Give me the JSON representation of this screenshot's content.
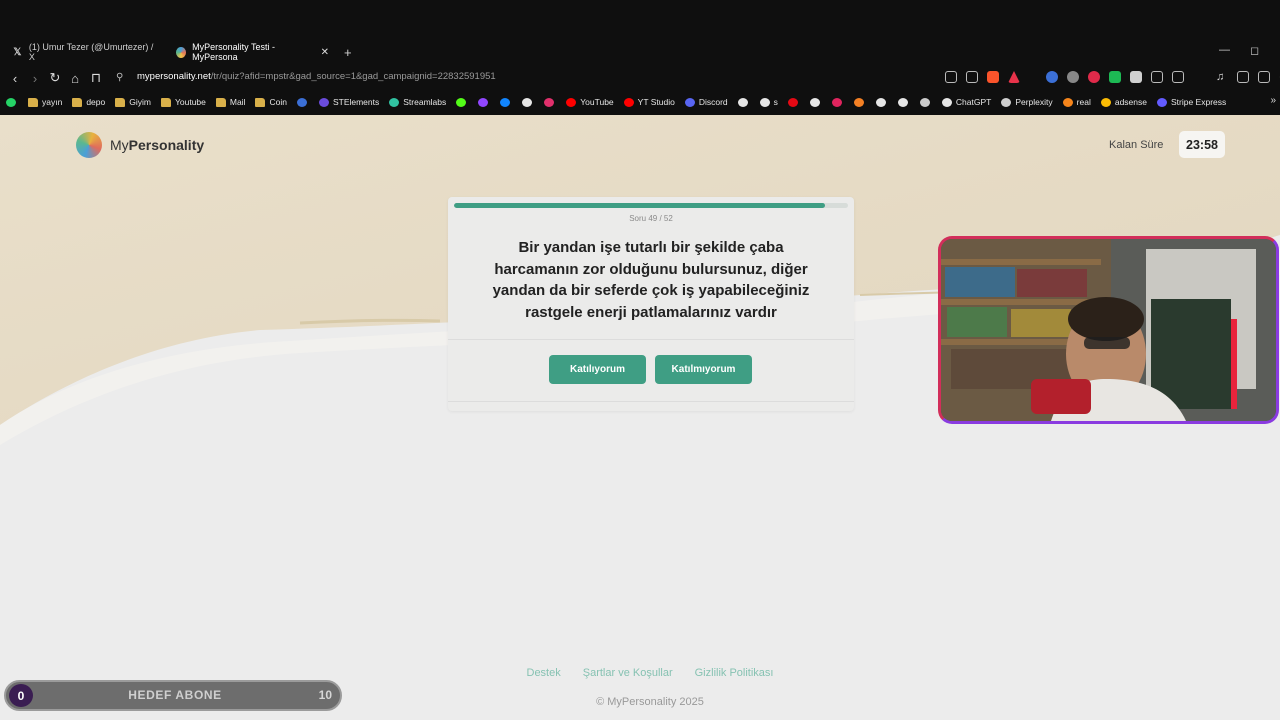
{
  "browser": {
    "tabs": [
      {
        "title": "(1) Umur Tezer (@Umurtezer) / X",
        "favicon": "x-icon"
      },
      {
        "title": "MyPersonality Testi - MyPersona",
        "favicon": "mypersonality-icon"
      }
    ],
    "new_tab": "+",
    "url_host": "mypersonality.net",
    "url_path": "/tr/quiz?afid=mpstr&gad_source=1&gad_campaignid=22832591951",
    "bookmarks": [
      {
        "label": "",
        "icon": "whatsapp-icon",
        "color": "#25d366"
      },
      {
        "label": "yayın",
        "icon": "folder-icon"
      },
      {
        "label": "depo",
        "icon": "folder-icon"
      },
      {
        "label": "Giyim",
        "icon": "folder-icon"
      },
      {
        "label": "Youtube",
        "icon": "folder-icon"
      },
      {
        "label": "Mail",
        "icon": "folder-icon"
      },
      {
        "label": "Coin",
        "icon": "folder-icon"
      },
      {
        "label": "",
        "icon": "r-icon",
        "color": "#3b6fd6"
      },
      {
        "label": "STElements",
        "icon": "stelements-icon",
        "color": "#6a4bdc"
      },
      {
        "label": "Streamlabs",
        "icon": "streamlabs-icon",
        "color": "#31c3a2"
      },
      {
        "label": "",
        "icon": "kick-icon",
        "color": "#53fc18"
      },
      {
        "label": "",
        "icon": "twitch-icon",
        "color": "#9146ff"
      },
      {
        "label": "",
        "icon": "bluesky-icon",
        "color": "#1185fe"
      },
      {
        "label": "",
        "icon": "x-icon",
        "color": "#e6e6e6"
      },
      {
        "label": "",
        "icon": "instagram-icon",
        "color": "#e1306c"
      },
      {
        "label": "YouTube",
        "icon": "youtube-icon",
        "color": "#ff0000"
      },
      {
        "label": "YT Studio",
        "icon": "yt-studio-icon",
        "color": "#ff0000"
      },
      {
        "label": "Discord",
        "icon": "discord-icon",
        "color": "#5865f2"
      },
      {
        "label": "",
        "icon": "tiktok-icon",
        "color": "#e6e6e6"
      },
      {
        "label": "s",
        "icon": "tiktok-icon",
        "color": "#e6e6e6"
      },
      {
        "label": "",
        "icon": "netflix-icon",
        "color": "#e50914"
      },
      {
        "label": "",
        "icon": "circle-icon",
        "color": "#e6e6e6"
      },
      {
        "label": "",
        "icon": "app-icon",
        "color": "#e0245e"
      },
      {
        "label": "",
        "icon": "app-icon",
        "color": "#f48024"
      },
      {
        "label": "",
        "icon": "amazon-icon",
        "color": "#e6e6e6"
      },
      {
        "label": "",
        "icon": "app-icon",
        "color": "#e6e6e6"
      },
      {
        "label": "",
        "icon": "app-icon",
        "color": "#cccccc"
      },
      {
        "label": "ChatGPT",
        "icon": "chatgpt-icon",
        "color": "#e6e6e6"
      },
      {
        "label": "Perplexity",
        "icon": "perplexity-icon",
        "color": "#cfcfcf"
      },
      {
        "label": "real",
        "icon": "fox-icon",
        "color": "#f6851b"
      },
      {
        "label": "adsense",
        "icon": "adsense-icon",
        "color": "#fbbc04"
      },
      {
        "label": "Stripe Express",
        "icon": "stripe-icon",
        "color": "#635bff"
      }
    ]
  },
  "header": {
    "logo_prefix": "My",
    "logo_bold": "Personality",
    "timer_label": "Kalan Süre",
    "timer_value": "23:58"
  },
  "quiz": {
    "progress_fraction": 0.9423,
    "counter": "Soru 49 / 52",
    "question": "Bir yandan işe tutarlı bir şekilde çaba harcamanın zor olduğunu bulursunuz, diğer yandan da bir seferde çok iş yapabileceğiniz rastgele enerji patlamalarınız vardır",
    "agree_label": "Katılıyorum",
    "disagree_label": "Katılmıyorum"
  },
  "footer": {
    "links": [
      "Destek",
      "Şartlar ve Koşullar",
      "Gizlilik Politikası"
    ],
    "copyright": "© MyPersonality 2025"
  },
  "stream_overlay": {
    "goal_current": "0",
    "goal_label": "HEDEF ABONE",
    "goal_target": "10"
  },
  "colors": {
    "accent": "#3f9e84",
    "hero_tan": "#e3d8c2"
  }
}
